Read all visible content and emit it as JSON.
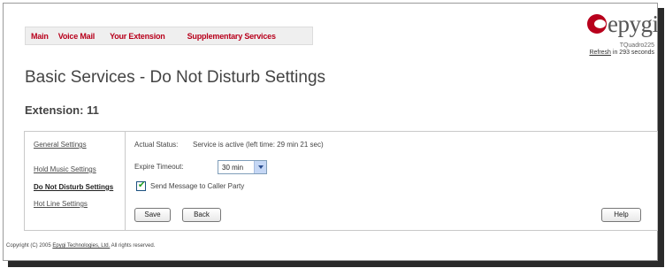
{
  "nav": {
    "items": [
      "Main",
      "Voice Mail",
      "Your Extension",
      "Supplementary Services"
    ]
  },
  "logo": {
    "brand": "epygi",
    "model": "TQuadro225",
    "refresh_link": "Refresh",
    "refresh_suffix": "in 293 seconds"
  },
  "page": {
    "title": "Basic Services - Do Not Disturb Settings",
    "extension_label": "Extension: 11"
  },
  "sidebar": {
    "items": [
      {
        "label": "General Settings"
      },
      {
        "label": "Hold Music Settings"
      },
      {
        "label": "Do Not Disturb Settings"
      },
      {
        "label": "Hot Line Settings"
      }
    ]
  },
  "form": {
    "status_label": "Actual Status:",
    "status_value": "Service is active (left time: 29 min 21 sec)",
    "expire_label": "Expire Timeout:",
    "expire_value": "30 min",
    "send_message_label": "Send Message to Caller Party",
    "send_message_checked": true,
    "save_label": "Save",
    "back_label": "Back",
    "help_label": "Help"
  },
  "footer": {
    "prefix": "Copyright (C) 2005",
    "company": "Epygi Technologies, Ltd.",
    "suffix": "All rights reserved."
  },
  "colors": {
    "accent": "#b8001c",
    "check": "#21a121",
    "select_arrow_bg": "#c5d7f5"
  }
}
